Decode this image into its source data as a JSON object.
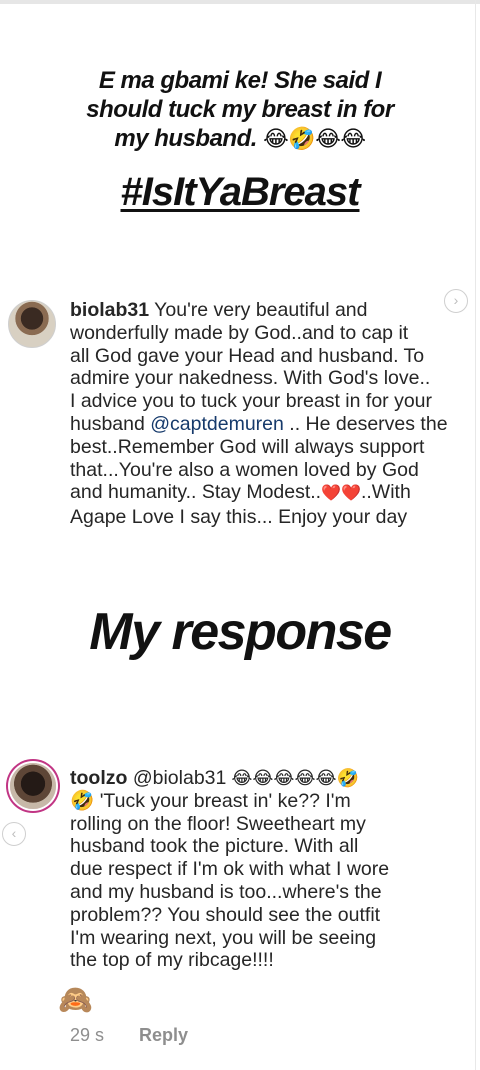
{
  "caption": {
    "line1": "E ma gbami ke! She said I",
    "line2": "should tuck my breast in for",
    "line3": "my husband.",
    "emojis": "😂🤣😂😂",
    "hashtag": "#IsItYaBreast"
  },
  "comment1": {
    "username": "biolab31",
    "text_part1": " You're very beautiful and\nwonderfully made by God..and to cap it\nall God gave your Head and husband. To\nadmire your nakedness. With God's love..\nI advice you to tuck your breast in for your\nhusband ",
    "mention": "@captdemuren",
    "text_part2": " .. He deserves the\nbest..Remember God will always support\nthat...You're also a women loved by God\nand humanity.. Stay Modest..",
    "hearts": "❤️❤️",
    "text_part3": "..With\nAgape Love I say this... Enjoy your day"
  },
  "response_title": "My response",
  "comment2": {
    "username": "toolzo",
    "mention": "@biolab31",
    "emojis_line1": " 😂😂😂😂😂🤣",
    "text": "🤣 'Tuck your breast in' ke?? I'm\nrolling on the floor! Sweetheart my\nhusband took the picture. With all\ndue respect if I'm ok with what I wore\nand my husband is too...where's the\nproblem?? You should see the outfit\nI'm wearing next, you will be seeing\n      the top of my ribcage!!!!",
    "monkey": "🙈",
    "time": "29 s",
    "reply": "Reply"
  },
  "icons": {
    "next": "chevron-right-icon",
    "prev": "chevron-left-icon"
  }
}
